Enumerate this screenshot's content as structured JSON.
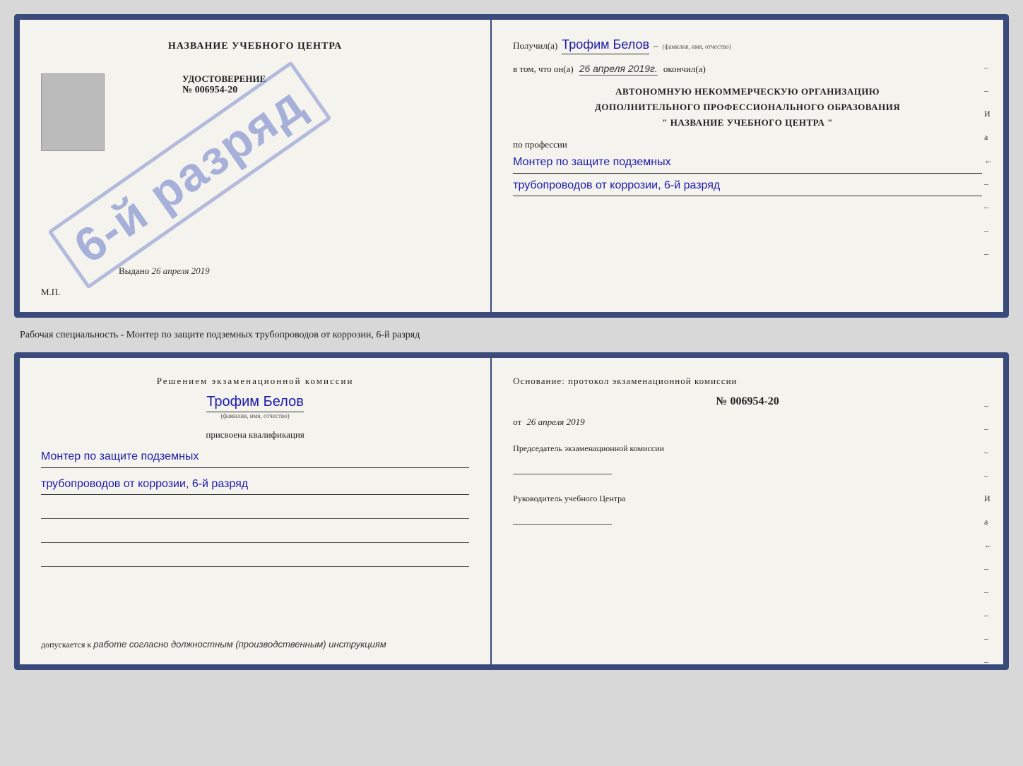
{
  "page": {
    "background_color": "#d8d8d8"
  },
  "diploma_top": {
    "left": {
      "title": "НАЗВАНИЕ УЧЕБНОГО ЦЕНТРА",
      "gray_box_label": "фото",
      "udost_label": "УДОСТОВЕРЕНИЕ",
      "udost_number": "№ 006954-20",
      "vydano_label": "Выдано",
      "vydano_date": "26 апреля 2019",
      "mp_label": "М.П."
    },
    "stamp": {
      "text": "6-й разряд"
    },
    "right": {
      "poluchil_label": "Получил(а)",
      "name_handwritten": "Трофим Белов",
      "name_hint": "(фамилия, имя, отчество)",
      "dash1": "–",
      "vtom_label": "в том, что он(а)",
      "date_handwritten": "26 апреля 2019г.",
      "okonchil_label": "окончил(а)",
      "org_line1": "АВТОНОМНУЮ НЕКОММЕРЧЕСКУЮ ОРГАНИЗАЦИЮ",
      "org_line2": "ДОПОЛНИТЕЛЬНОГО ПРОФЕССИОНАЛЬНОГО ОБРАЗОВАНИЯ",
      "org_line3": "\"   НАЗВАНИЕ УЧЕБНОГО ЦЕНТРА   \"",
      "po_professii_label": "по профессии",
      "prof_handwritten_line1": "Монтер по защите подземных",
      "prof_handwritten_line2": "трубопроводов от коррозии, 6-й разряд",
      "side_chars": [
        "–",
        "–",
        "И",
        "а",
        "←",
        "–",
        "–",
        "–",
        "–"
      ]
    }
  },
  "middle_text": "Рабочая специальность - Монтер по защите подземных трубопроводов от коррозии, 6-й разряд",
  "diploma_bottom": {
    "left": {
      "decision_title": "Решением  экзаменационной  комиссии",
      "name_handwritten": "Трофим Белов",
      "name_hint": "(фамилия, имя, отчество)",
      "prisvoyena_label": "присвоена квалификация",
      "prof_line1": "Монтер по защите подземных",
      "prof_line2": "трубопроводов от коррозии, 6-й разряд",
      "blank_lines": [
        "",
        "",
        ""
      ],
      "dopuskaetsya_label": "допускается к",
      "dopuskaetsya_value": "работе согласно должностным (производственным) инструкциям"
    },
    "right": {
      "osnov_label": "Основание: протокол экзаменационной  комиссии",
      "protocol_number": "№  006954-20",
      "ot_label": "от",
      "ot_date": "26 апреля 2019",
      "chair_label": "Председатель экзаменационной комиссии",
      "ruk_label": "Руководитель учебного Центра",
      "side_chars": [
        "–",
        "–",
        "–",
        "–",
        "И",
        "а",
        "←",
        "–",
        "–",
        "–",
        "–",
        "–"
      ]
    }
  }
}
